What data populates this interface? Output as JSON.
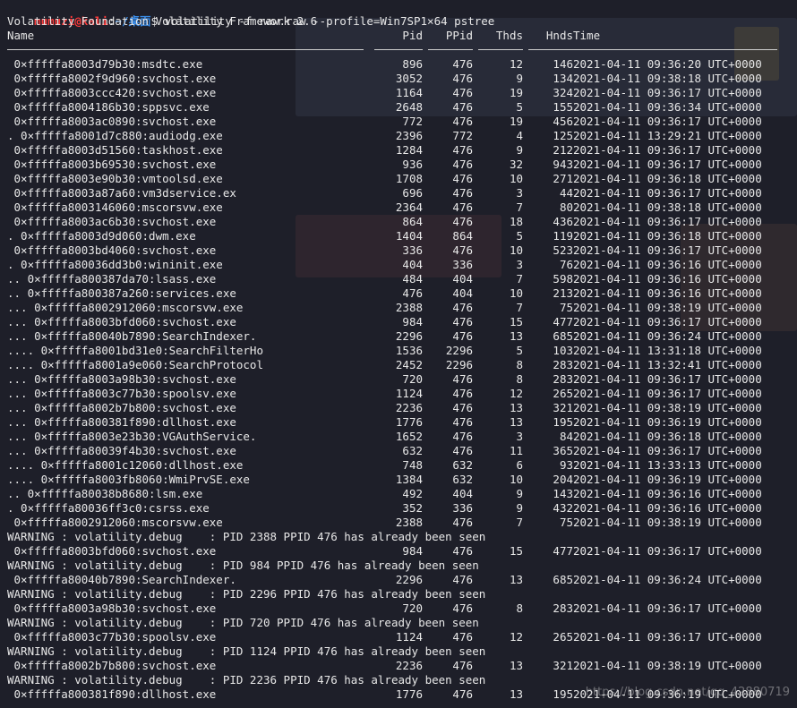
{
  "prompt": {
    "user_host": "mumuzi@kali",
    "path": "~/桌面",
    "symbol": "$",
    "command": "volatility -f raw.raw --profile=Win7SP1×64 pstree"
  },
  "banner": "Volatility Foundation Volatility Framework 2.6",
  "columns": [
    "Name",
    "Pid",
    "PPid",
    "Thds",
    "Hnds",
    "Time"
  ],
  "rows": [
    {
      "name": " 0×fffffa8003d79b30:msdtc.exe",
      "pid": "896",
      "ppid": "476",
      "thds": "12",
      "hnds": "146",
      "time": "2021-04-11 09:36:20 UTC+0000"
    },
    {
      "name": " 0×fffffa8002f9d960:svchost.exe",
      "pid": "3052",
      "ppid": "476",
      "thds": "9",
      "hnds": "134",
      "time": "2021-04-11 09:38:18 UTC+0000"
    },
    {
      "name": " 0×fffffa8003ccc420:svchost.exe",
      "pid": "1164",
      "ppid": "476",
      "thds": "19",
      "hnds": "324",
      "time": "2021-04-11 09:36:17 UTC+0000"
    },
    {
      "name": " 0×fffffa8004186b30:sppsvc.exe",
      "pid": "2648",
      "ppid": "476",
      "thds": "5",
      "hnds": "155",
      "time": "2021-04-11 09:36:34 UTC+0000"
    },
    {
      "name": " 0×fffffa8003ac0890:svchost.exe",
      "pid": "772",
      "ppid": "476",
      "thds": "19",
      "hnds": "456",
      "time": "2021-04-11 09:36:17 UTC+0000"
    },
    {
      "name": ". 0×fffffa8001d7c880:audiodg.exe",
      "pid": "2396",
      "ppid": "772",
      "thds": "4",
      "hnds": "125",
      "time": "2021-04-11 13:29:21 UTC+0000"
    },
    {
      "name": " 0×fffffa8003d51560:taskhost.exe",
      "pid": "1284",
      "ppid": "476",
      "thds": "9",
      "hnds": "212",
      "time": "2021-04-11 09:36:17 UTC+0000"
    },
    {
      "name": " 0×fffffa8003b69530:svchost.exe",
      "pid": "936",
      "ppid": "476",
      "thds": "32",
      "hnds": "943",
      "time": "2021-04-11 09:36:17 UTC+0000"
    },
    {
      "name": " 0×fffffa8003e90b30:vmtoolsd.exe",
      "pid": "1708",
      "ppid": "476",
      "thds": "10",
      "hnds": "271",
      "time": "2021-04-11 09:36:18 UTC+0000"
    },
    {
      "name": " 0×fffffa8003a87a60:vm3dservice.ex",
      "pid": "696",
      "ppid": "476",
      "thds": "3",
      "hnds": "44",
      "time": "2021-04-11 09:36:17 UTC+0000"
    },
    {
      "name": " 0×fffffa8003146060:mscorsvw.exe",
      "pid": "2364",
      "ppid": "476",
      "thds": "7",
      "hnds": "80",
      "time": "2021-04-11 09:38:18 UTC+0000"
    },
    {
      "name": " 0×fffffa8003ac6b30:svchost.exe",
      "pid": "864",
      "ppid": "476",
      "thds": "18",
      "hnds": "436",
      "time": "2021-04-11 09:36:17 UTC+0000"
    },
    {
      "name": ". 0×fffffa8003d9d060:dwm.exe",
      "pid": "1404",
      "ppid": "864",
      "thds": "5",
      "hnds": "119",
      "time": "2021-04-11 09:36:18 UTC+0000"
    },
    {
      "name": " 0×fffffa8003bd4060:svchost.exe",
      "pid": "336",
      "ppid": "476",
      "thds": "10",
      "hnds": "523",
      "time": "2021-04-11 09:36:17 UTC+0000"
    },
    {
      "name": ". 0×fffffa80036dd3b0:wininit.exe",
      "pid": "404",
      "ppid": "336",
      "thds": "3",
      "hnds": "76",
      "time": "2021-04-11 09:36:16 UTC+0000"
    },
    {
      "name": ".. 0×fffffa800387da70:lsass.exe",
      "pid": "484",
      "ppid": "404",
      "thds": "7",
      "hnds": "598",
      "time": "2021-04-11 09:36:16 UTC+0000"
    },
    {
      "name": ".. 0×fffffa800387a260:services.exe",
      "pid": "476",
      "ppid": "404",
      "thds": "10",
      "hnds": "213",
      "time": "2021-04-11 09:36:16 UTC+0000"
    },
    {
      "name": "... 0×fffffa8002912060:mscorsvw.exe",
      "pid": "2388",
      "ppid": "476",
      "thds": "7",
      "hnds": "75",
      "time": "2021-04-11 09:38:19 UTC+0000"
    },
    {
      "name": "... 0×fffffa8003bfd060:svchost.exe",
      "pid": "984",
      "ppid": "476",
      "thds": "15",
      "hnds": "477",
      "time": "2021-04-11 09:36:17 UTC+0000"
    },
    {
      "name": "... 0×fffffa80040b7890:SearchIndexer.",
      "pid": "2296",
      "ppid": "476",
      "thds": "13",
      "hnds": "685",
      "time": "2021-04-11 09:36:24 UTC+0000"
    },
    {
      "name": ".... 0×fffffa8001bd31e0:SearchFilterHo",
      "pid": "1536",
      "ppid": "2296",
      "thds": "5",
      "hnds": "103",
      "time": "2021-04-11 13:31:18 UTC+0000"
    },
    {
      "name": ".... 0×fffffa8001a9e060:SearchProtocol",
      "pid": "2452",
      "ppid": "2296",
      "thds": "8",
      "hnds": "283",
      "time": "2021-04-11 13:32:41 UTC+0000"
    },
    {
      "name": "... 0×fffffa8003a98b30:svchost.exe",
      "pid": "720",
      "ppid": "476",
      "thds": "8",
      "hnds": "283",
      "time": "2021-04-11 09:36:17 UTC+0000"
    },
    {
      "name": "... 0×fffffa8003c77b30:spoolsv.exe",
      "pid": "1124",
      "ppid": "476",
      "thds": "12",
      "hnds": "265",
      "time": "2021-04-11 09:36:17 UTC+0000"
    },
    {
      "name": "... 0×fffffa8002b7b800:svchost.exe",
      "pid": "2236",
      "ppid": "476",
      "thds": "13",
      "hnds": "321",
      "time": "2021-04-11 09:38:19 UTC+0000"
    },
    {
      "name": "... 0×fffffa800381f890:dllhost.exe",
      "pid": "1776",
      "ppid": "476",
      "thds": "13",
      "hnds": "195",
      "time": "2021-04-11 09:36:19 UTC+0000"
    },
    {
      "name": "... 0×fffffa8003e23b30:VGAuthService.",
      "pid": "1652",
      "ppid": "476",
      "thds": "3",
      "hnds": "84",
      "time": "2021-04-11 09:36:18 UTC+0000"
    },
    {
      "name": "... 0×fffffa80039f4b30:svchost.exe",
      "pid": "632",
      "ppid": "476",
      "thds": "11",
      "hnds": "365",
      "time": "2021-04-11 09:36:17 UTC+0000"
    },
    {
      "name": ".... 0×fffffa8001c12060:dllhost.exe",
      "pid": "748",
      "ppid": "632",
      "thds": "6",
      "hnds": "93",
      "time": "2021-04-11 13:33:13 UTC+0000"
    },
    {
      "name": ".... 0×fffffa8003fb8060:WmiPrvSE.exe",
      "pid": "1384",
      "ppid": "632",
      "thds": "10",
      "hnds": "204",
      "time": "2021-04-11 09:36:19 UTC+0000"
    },
    {
      "name": ".. 0×fffffa80038b8680:lsm.exe",
      "pid": "492",
      "ppid": "404",
      "thds": "9",
      "hnds": "143",
      "time": "2021-04-11 09:36:16 UTC+0000"
    },
    {
      "name": ". 0×fffffa80036ff3c0:csrss.exe",
      "pid": "352",
      "ppid": "336",
      "thds": "9",
      "hnds": "432",
      "time": "2021-04-11 09:36:16 UTC+0000"
    },
    {
      "name": " 0×fffffa8002912060:mscorsvw.exe",
      "pid": "2388",
      "ppid": "476",
      "thds": "7",
      "hnds": "75",
      "time": "2021-04-11 09:38:19 UTC+0000"
    },
    {
      "warning": "WARNING : volatility.debug    : PID 2388 PPID 476 has already been seen"
    },
    {
      "name": " 0×fffffa8003bfd060:svchost.exe",
      "pid": "984",
      "ppid": "476",
      "thds": "15",
      "hnds": "477",
      "time": "2021-04-11 09:36:17 UTC+0000"
    },
    {
      "warning": "WARNING : volatility.debug    : PID 984 PPID 476 has already been seen"
    },
    {
      "name": " 0×fffffa80040b7890:SearchIndexer.",
      "pid": "2296",
      "ppid": "476",
      "thds": "13",
      "hnds": "685",
      "time": "2021-04-11 09:36:24 UTC+0000"
    },
    {
      "warning": "WARNING : volatility.debug    : PID 2296 PPID 476 has already been seen"
    },
    {
      "name": " 0×fffffa8003a98b30:svchost.exe",
      "pid": "720",
      "ppid": "476",
      "thds": "8",
      "hnds": "283",
      "time": "2021-04-11 09:36:17 UTC+0000"
    },
    {
      "warning": "WARNING : volatility.debug    : PID 720 PPID 476 has already been seen"
    },
    {
      "name": " 0×fffffa8003c77b30:spoolsv.exe",
      "pid": "1124",
      "ppid": "476",
      "thds": "12",
      "hnds": "265",
      "time": "2021-04-11 09:36:17 UTC+0000"
    },
    {
      "warning": "WARNING : volatility.debug    : PID 1124 PPID 476 has already been seen"
    },
    {
      "name": " 0×fffffa8002b7b800:svchost.exe",
      "pid": "2236",
      "ppid": "476",
      "thds": "13",
      "hnds": "321",
      "time": "2021-04-11 09:38:19 UTC+0000"
    },
    {
      "warning": "WARNING : volatility.debug    : PID 2236 PPID 476 has already been seen"
    },
    {
      "name": " 0×fffffa800381f890:dllhost.exe",
      "pid": "1776",
      "ppid": "476",
      "thds": "13",
      "hnds": "195",
      "time": "2021-04-11 09:36:19 UTC+0000"
    }
  ],
  "watermark": "https://blog.csdn.net/qq_42880719"
}
